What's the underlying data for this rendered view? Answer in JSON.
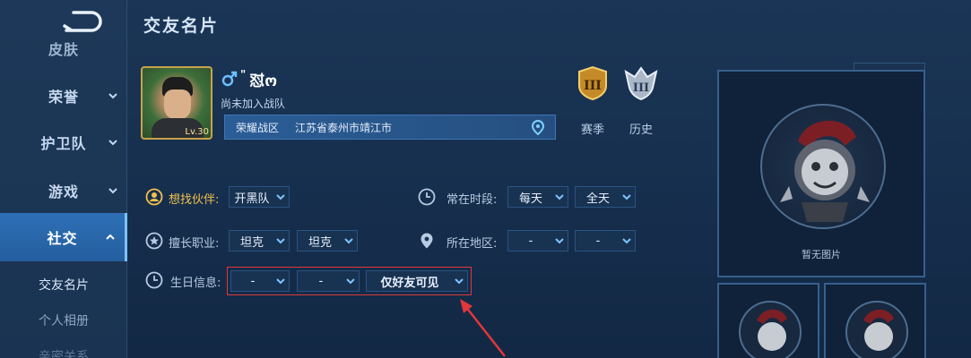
{
  "sidebar": {
    "items": [
      {
        "label": "皮肤",
        "partial": true
      },
      {
        "label": "荣誉"
      },
      {
        "label": "护卫队"
      },
      {
        "label": "游戏"
      },
      {
        "label": "社交",
        "active": true
      }
    ],
    "subitems": [
      {
        "label": "交友名片",
        "current": true
      },
      {
        "label": "个人相册"
      },
      {
        "label": "亲密关系"
      }
    ]
  },
  "page": {
    "title": "交友名片"
  },
  "profile": {
    "name": "怼ო",
    "name_mark": "\"",
    "level": "Lv.30",
    "team_status": "尚未加入战队",
    "zone": "荣耀战区",
    "location": "江苏省泰州市靖江市",
    "season_label": "赛季",
    "history_label": "历史",
    "season_rank_numeral": "III",
    "history_rank_numeral": "III"
  },
  "form": {
    "partner": {
      "label": "想找伙伴:",
      "value": "开黑队"
    },
    "time": {
      "label": "常在时段:",
      "day": "每天",
      "period": "全天"
    },
    "role": {
      "label": "擅长职业:",
      "first": "坦克",
      "second": "坦克"
    },
    "region": {
      "label": "所在地区:",
      "first": "-",
      "second": "-"
    },
    "birthday": {
      "label": "生日信息:",
      "month": "-",
      "day": "-",
      "visibility": "仅好友可见"
    }
  },
  "album": {
    "empty_text": "暂无图片"
  },
  "colors": {
    "accent": "#2e6fb5",
    "highlight": "#e0373a",
    "gold": "#f2c14d"
  }
}
